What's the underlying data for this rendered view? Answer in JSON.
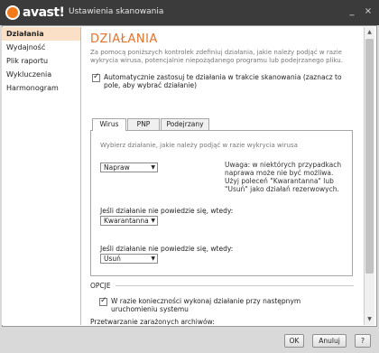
{
  "window": {
    "brand": "avast!",
    "title": "Ustawienia skanowania",
    "minimize_glyph": "_",
    "close_glyph": "×"
  },
  "sidebar": {
    "items": [
      {
        "label": "Działania",
        "active": true
      },
      {
        "label": "Wydajność",
        "active": false
      },
      {
        "label": "Plik raportu",
        "active": false
      },
      {
        "label": "Wykluczenia",
        "active": false
      },
      {
        "label": "Harmonogram",
        "active": false
      }
    ]
  },
  "main": {
    "title": "DZIAŁANIA",
    "description": "Za pomocą poniższych kontrolek zdefiniuj działania, jakie należy podjąć w razie wykrycia wirusa, potencjalnie niepożądanego programu lub podejrzanego pliku.",
    "auto_apply": {
      "checked": true,
      "label": "Automatycznie zastosuj te działania w trakcie skanowania (zaznacz to pole, aby wybrać działanie)"
    },
    "tabs": [
      {
        "label": "Wirus",
        "active": true
      },
      {
        "label": "PNP",
        "active": false
      },
      {
        "label": "Podejrzany",
        "active": false
      }
    ],
    "panel": {
      "instruction": "Wybierz działanie, jakie należy podjąć w razie wykrycia wirusa",
      "primary_action": "Napraw",
      "note": "Uwaga: w niektórych przypadkach naprawa może nie być możliwa. Użyj poleceń \"Kwarantanna\" lub \"Usuń\" jako działań rezerwowych.",
      "fallback_label_1": "Jeśli działanie nie powiedzie się, wtedy:",
      "fallback_action_1": "Kwarantanna",
      "fallback_label_2": "Jeśli działanie nie powiedzie się, wtedy:",
      "fallback_action_2": "Usuń"
    },
    "options": {
      "title": "OPCJE",
      "reboot_check": {
        "checked": true,
        "label": "W razie konieczności wykonaj działanie przy następnym uruchomieniu systemu"
      },
      "archives_label": "Przetwarzanie zarażonych archiwów:"
    }
  },
  "footer": {
    "ok": "OK",
    "cancel": "Anuluj",
    "help": "?"
  },
  "colors": {
    "accent": "#e8722a",
    "active_nav": "#fbe0c8",
    "titlebar": "#3b3b3b"
  }
}
